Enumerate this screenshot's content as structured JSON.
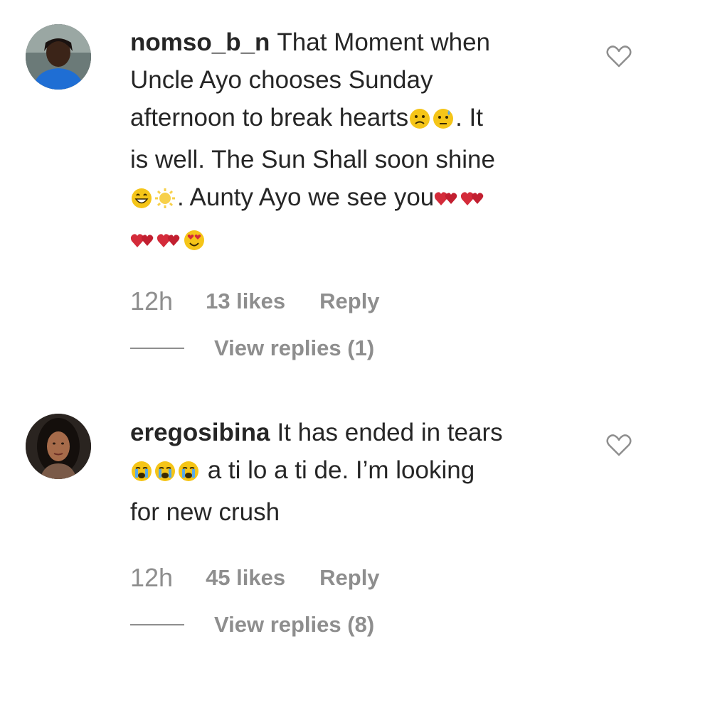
{
  "comments": [
    {
      "username": "nomso_b_n",
      "lines": [
        {
          "text": "That Moment when",
          "emoji_after": []
        },
        {
          "text": "Uncle Ayo chooses Sunday",
          "emoji_after": []
        },
        {
          "text": "afternoon to break hearts",
          "emoji_after": [
            "frown",
            "worried-sweat"
          ],
          "suffix": ". It"
        },
        {
          "text": "is well. The Sun Shall soon shine",
          "emoji_after": []
        },
        {
          "prefix_emoji": [
            "grin-sweat",
            "sun"
          ],
          "text": ". Aunty Ayo we see you",
          "emoji_after": [
            "heart-pair",
            "heart-pair"
          ]
        },
        {
          "prefix_emoji": [
            "heart-pair",
            "heart-pair",
            "heart-eyes"
          ],
          "text": "",
          "emoji_after": []
        }
      ],
      "time": "12h",
      "likes": "13 likes",
      "reply_label": "Reply",
      "view_replies": "View replies (1)"
    },
    {
      "username": "eregosibina",
      "lines": [
        {
          "text": "It has ended in tears",
          "emoji_after": []
        },
        {
          "prefix_emoji": [
            "crying",
            "crying",
            "crying"
          ],
          "text": " a ti lo a ti de. I’m looking",
          "emoji_after": []
        },
        {
          "text": "for new crush",
          "emoji_after": []
        }
      ],
      "time": "12h",
      "likes": "45 likes",
      "reply_label": "Reply",
      "view_replies": "View replies (8)"
    }
  ],
  "icons": {
    "like": "heart-outline-icon"
  },
  "colors": {
    "text": "#262626",
    "secondary": "#8e8e8e",
    "heart_red": "#d42b3a",
    "emoji_yellow": "#f5c518"
  }
}
